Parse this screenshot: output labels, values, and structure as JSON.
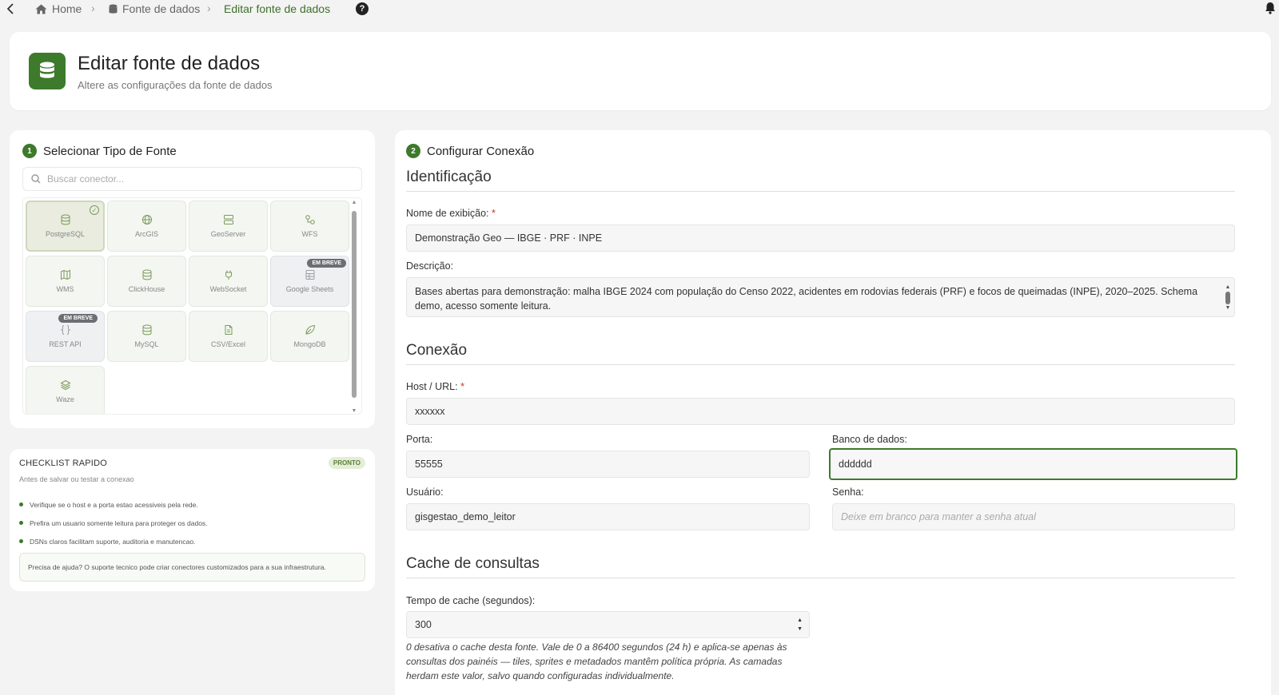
{
  "breadcrumb": {
    "home": "Home",
    "datasources": "Fonte de dados",
    "current": "Editar fonte de dados",
    "help_symbol": "?"
  },
  "header": {
    "title": "Editar fonte de dados",
    "subtitle": "Altere as configurações da fonte de dados"
  },
  "step1": {
    "num": "1",
    "title": "Selecionar Tipo de Fonte",
    "search_placeholder": "Buscar conector...",
    "connectors": [
      {
        "label": "PostgreSQL",
        "icon": "database-icon",
        "selected": true
      },
      {
        "label": "ArcGIS",
        "icon": "globe-icon"
      },
      {
        "label": "GeoServer",
        "icon": "server-icon"
      },
      {
        "label": "WFS",
        "icon": "nodes-icon"
      },
      {
        "label": "WMS",
        "icon": "map-icon"
      },
      {
        "label": "ClickHouse",
        "icon": "database-icon"
      },
      {
        "label": "WebSocket",
        "icon": "plug-icon"
      },
      {
        "label": "Google Sheets",
        "icon": "sheet-icon",
        "badge": "EM BREVE"
      },
      {
        "label": "REST API",
        "icon": "braces-icon",
        "badge": "EM BREVE"
      },
      {
        "label": "MySQL",
        "icon": "database-icon"
      },
      {
        "label": "CSV/Excel",
        "icon": "file-icon"
      },
      {
        "label": "MongoDB",
        "icon": "leaf-icon"
      },
      {
        "label": "Waze",
        "icon": "layers-icon"
      }
    ]
  },
  "checklist": {
    "title": "CHECKLIST RAPIDO",
    "badge": "PRONTO",
    "subtitle": "Antes de salvar ou testar a conexao",
    "items": [
      "Verifique se o host e a porta estao acessiveis pela rede.",
      "Prefira um usuario somente leitura para proteger os dados.",
      "DSNs claros facilitam suporte, auditoria e manutencao."
    ],
    "help": "Precisa de ajuda? O suporte tecnico pode criar conectores customizados para a sua infraestrutura."
  },
  "step2": {
    "num": "2",
    "title": "Configurar Conexão"
  },
  "identification": {
    "heading": "Identificação",
    "name_label": "Nome de exibição:",
    "name_value": "Demonstração Geo — IBGE · PRF · INPE",
    "desc_label": "Descrição:",
    "desc_value": "Bases abertas para demonstração: malha IBGE 2024 com população do Censo 2022, acidentes em rodovias federais (PRF) e focos de queimadas (INPE), 2020–2025. Schema demo, acesso somente leitura."
  },
  "connection": {
    "heading": "Conexão",
    "host_label": "Host / URL:",
    "host_value": "xxxxxx",
    "port_label": "Porta:",
    "port_value": "55555",
    "db_label": "Banco de dados:",
    "db_value": "dddddd",
    "user_label": "Usuário:",
    "user_value": "gisgestao_demo_leitor",
    "pass_label": "Senha:",
    "pass_placeholder": "Deixe em branco para manter a senha atual"
  },
  "cache": {
    "heading": "Cache de consultas",
    "label": "Tempo de cache (segundos):",
    "value": "300",
    "hint": "0 desativa o cache desta fonte. Vale de 0 a 86400 segundos (24 h) e aplica-se apenas às consultas dos painéis — tiles, sprites e metadados mantêm política própria. As camadas herdam este valor, salvo quando configuradas individualmente."
  },
  "required_mark": "*",
  "colors": {
    "brand": "#3d7a2b",
    "background": "#f3f3f3"
  }
}
